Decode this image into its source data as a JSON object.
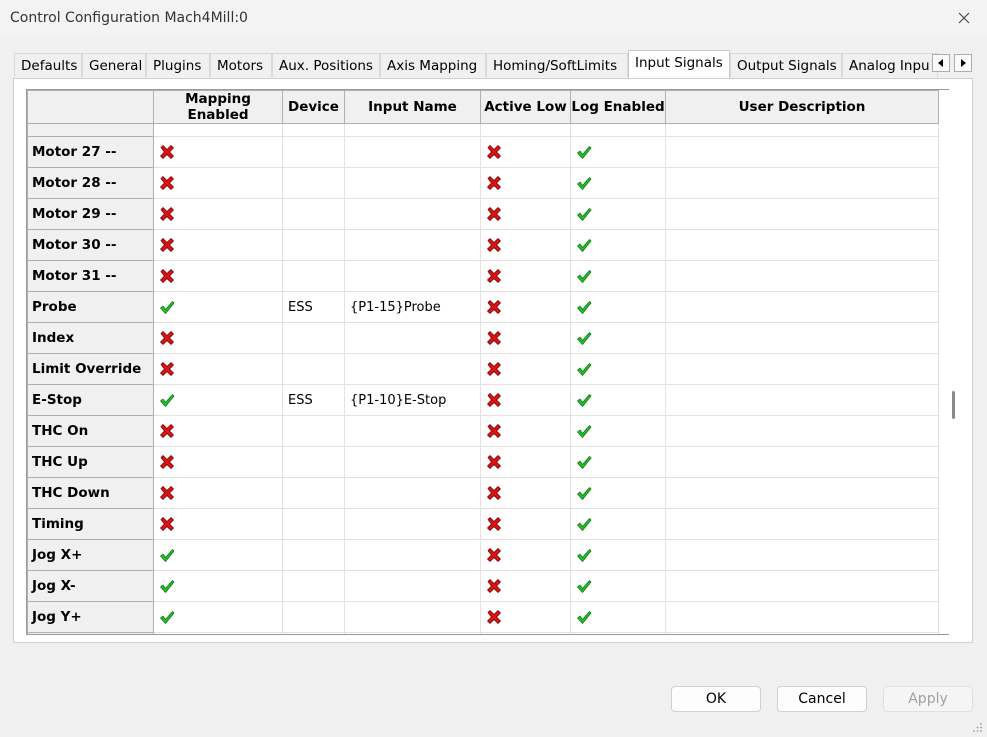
{
  "window": {
    "title": "Control Configuration Mach4Mill:0"
  },
  "tabs": [
    {
      "label": "Defaults"
    },
    {
      "label": "General"
    },
    {
      "label": "Plugins"
    },
    {
      "label": "Motors"
    },
    {
      "label": "Aux. Positions"
    },
    {
      "label": "Axis Mapping"
    },
    {
      "label": "Homing/SoftLimits"
    },
    {
      "label": "Input Signals",
      "active": true
    },
    {
      "label": "Output Signals"
    },
    {
      "label": "Analog Inpu"
    }
  ],
  "table": {
    "columns": [
      "",
      "Mapping Enabled",
      "Device",
      "Input Name",
      "Active Low",
      "Log Enabled",
      "User Description"
    ],
    "rows": [
      {
        "name": "Motor 27 --",
        "mapping_enabled": false,
        "device": "",
        "input_name": "",
        "active_low": false,
        "log_enabled": true,
        "description": ""
      },
      {
        "name": "Motor 28 --",
        "mapping_enabled": false,
        "device": "",
        "input_name": "",
        "active_low": false,
        "log_enabled": true,
        "description": ""
      },
      {
        "name": "Motor 29 --",
        "mapping_enabled": false,
        "device": "",
        "input_name": "",
        "active_low": false,
        "log_enabled": true,
        "description": ""
      },
      {
        "name": "Motor 30 --",
        "mapping_enabled": false,
        "device": "",
        "input_name": "",
        "active_low": false,
        "log_enabled": true,
        "description": ""
      },
      {
        "name": "Motor 31 --",
        "mapping_enabled": false,
        "device": "",
        "input_name": "",
        "active_low": false,
        "log_enabled": true,
        "description": ""
      },
      {
        "name": "Probe",
        "mapping_enabled": true,
        "device": "ESS",
        "input_name": "{P1-15}Probe",
        "active_low": false,
        "log_enabled": true,
        "description": ""
      },
      {
        "name": "Index",
        "mapping_enabled": false,
        "device": "",
        "input_name": "",
        "active_low": false,
        "log_enabled": true,
        "description": ""
      },
      {
        "name": "Limit Override",
        "mapping_enabled": false,
        "device": "",
        "input_name": "",
        "active_low": false,
        "log_enabled": true,
        "description": ""
      },
      {
        "name": "E-Stop",
        "mapping_enabled": true,
        "device": "ESS",
        "input_name": "{P1-10}E-Stop",
        "active_low": false,
        "log_enabled": true,
        "description": ""
      },
      {
        "name": "THC On",
        "mapping_enabled": false,
        "device": "",
        "input_name": "",
        "active_low": false,
        "log_enabled": true,
        "description": ""
      },
      {
        "name": "THC Up",
        "mapping_enabled": false,
        "device": "",
        "input_name": "",
        "active_low": false,
        "log_enabled": true,
        "description": ""
      },
      {
        "name": "THC Down",
        "mapping_enabled": false,
        "device": "",
        "input_name": "",
        "active_low": false,
        "log_enabled": true,
        "description": ""
      },
      {
        "name": "Timing",
        "mapping_enabled": false,
        "device": "",
        "input_name": "",
        "active_low": false,
        "log_enabled": true,
        "description": ""
      },
      {
        "name": "Jog X+",
        "mapping_enabled": true,
        "device": "",
        "input_name": "",
        "active_low": false,
        "log_enabled": true,
        "description": ""
      },
      {
        "name": "Jog X-",
        "mapping_enabled": true,
        "device": "",
        "input_name": "",
        "active_low": false,
        "log_enabled": true,
        "description": ""
      },
      {
        "name": "Jog Y+",
        "mapping_enabled": true,
        "device": "",
        "input_name": "",
        "active_low": false,
        "log_enabled": true,
        "description": ""
      }
    ]
  },
  "buttons": {
    "ok": "OK",
    "cancel": "Cancel",
    "apply": "Apply"
  },
  "icons": {
    "true_mark": "green-check-icon",
    "false_mark": "red-x-icon",
    "close": "close-icon",
    "tab_left": "scroll-left-icon",
    "tab_right": "scroll-right-icon"
  },
  "colors": {
    "check": "#22c02a",
    "cross": "#d81414",
    "header_bg": "#f0f0f0"
  }
}
